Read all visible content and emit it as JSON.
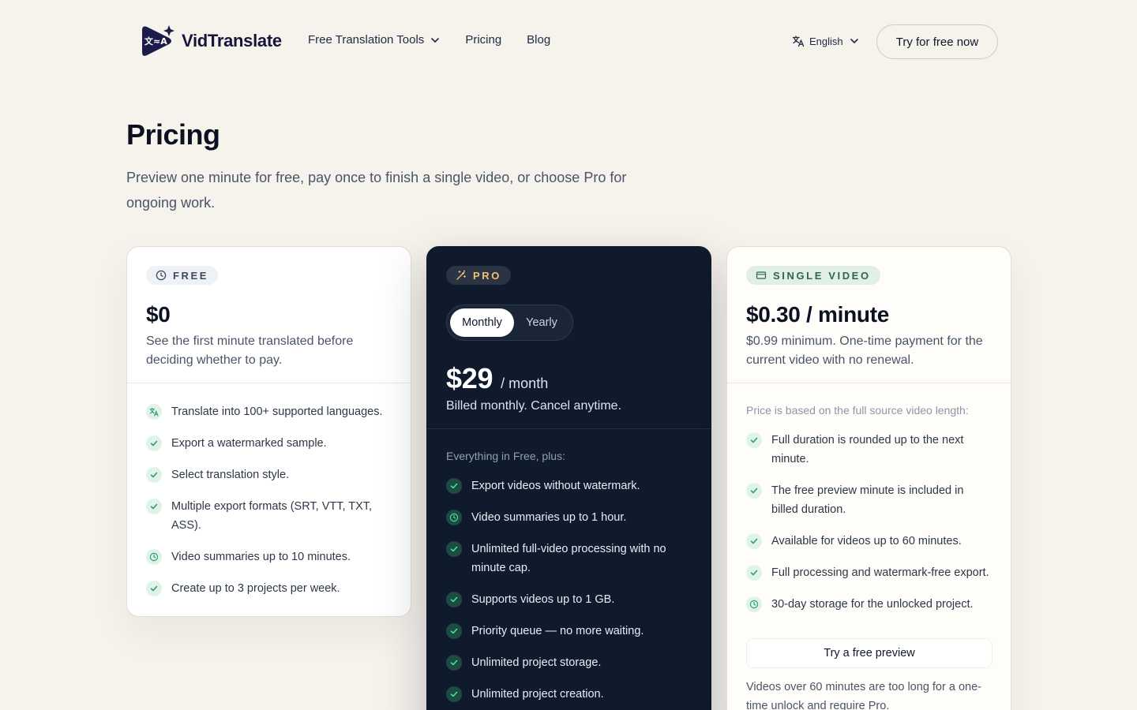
{
  "brand": {
    "name": "VidTranslate",
    "logo_glyph": "文≈A"
  },
  "nav": {
    "items": [
      {
        "label": "Free Translation Tools",
        "has_dropdown": true
      },
      {
        "label": "Pricing",
        "has_dropdown": false
      },
      {
        "label": "Blog",
        "has_dropdown": false
      }
    ],
    "language": "English",
    "cta": "Try for free now"
  },
  "hero": {
    "title": "Pricing",
    "subtitle": "Preview one minute for free, pay once to finish a single video, or choose Pro for ongoing work."
  },
  "plans": {
    "free": {
      "badge": "FREE",
      "price": "$0",
      "description": "See the first minute translated before deciding whether to pay.",
      "features": [
        {
          "icon": "translate-icon",
          "text": "Translate into 100+ supported languages."
        },
        {
          "icon": "check-icon",
          "text": "Export a watermarked sample."
        },
        {
          "icon": "check-icon",
          "text": "Select translation style."
        },
        {
          "icon": "check-icon",
          "text": "Multiple export formats (SRT, VTT, TXT, ASS)."
        },
        {
          "icon": "clock-icon",
          "text": "Video summaries up to 10 minutes."
        },
        {
          "icon": "check-icon",
          "text": "Create up to 3 projects per week."
        }
      ]
    },
    "pro": {
      "badge": "PRO",
      "toggle": {
        "monthly": "Monthly",
        "yearly": "Yearly",
        "selected": "Monthly"
      },
      "price": "$29",
      "period": "/ month",
      "description": "Billed monthly. Cancel anytime.",
      "lead": "Everything in Free, plus:",
      "features": [
        {
          "icon": "check-icon",
          "text": "Export videos without watermark."
        },
        {
          "icon": "clock-icon",
          "text": "Video summaries up to 1 hour."
        },
        {
          "icon": "check-icon",
          "text": "Unlimited full-video processing with no minute cap."
        },
        {
          "icon": "check-icon",
          "text": "Supports videos up to 1 GB."
        },
        {
          "icon": "check-icon",
          "text": "Priority queue — no more waiting."
        },
        {
          "icon": "check-icon",
          "text": "Unlimited project storage."
        },
        {
          "icon": "check-icon",
          "text": "Unlimited project creation."
        }
      ]
    },
    "single": {
      "badge": "SINGLE VIDEO",
      "price": "$0.30 / minute",
      "description": "$0.99 minimum. One-time payment for the current video with no renewal.",
      "lead": "Price is based on the full source video length:",
      "features": [
        {
          "icon": "check-icon",
          "text": "Full duration is rounded up to the next minute."
        },
        {
          "icon": "check-icon",
          "text": "The free preview minute is included in billed duration."
        },
        {
          "icon": "check-icon",
          "text": "Available for videos up to 60 minutes."
        },
        {
          "icon": "check-icon",
          "text": "Full processing and watermark-free export."
        },
        {
          "icon": "clock-icon",
          "text": "30-day storage for the unlocked project."
        }
      ],
      "button": "Try a free preview",
      "footnote": "Videos over 60 minutes are too long for a one-time unlock and require Pro."
    }
  },
  "colors": {
    "background": "#f6f2ec",
    "pro_card": "#0f1b2d",
    "accent_green": "#2f9e6e",
    "pro_badge": "#f0c26a"
  }
}
